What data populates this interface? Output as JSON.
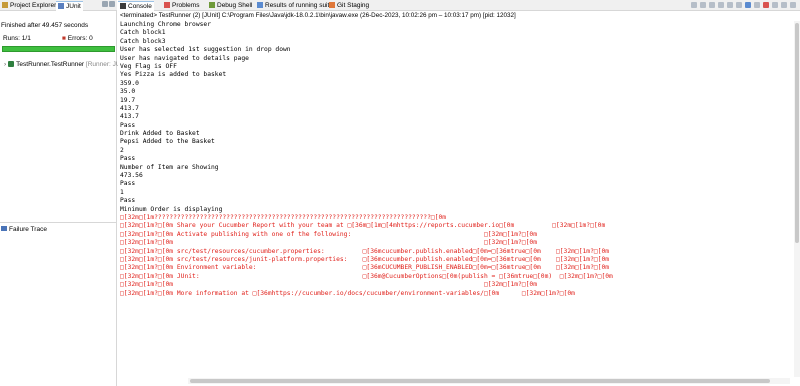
{
  "left_panel": {
    "tab_project_explorer": "Project Explorer",
    "tab_junit": "JUnit",
    "finished_text": "Finished after 49.457 seconds",
    "runs_label": "Runs:",
    "runs_value": "1/1",
    "errors_label": "Errors:",
    "errors_value": "0",
    "progress_fraction": 1.0,
    "tree_item_name": "TestRunner.TestRunner",
    "tree_item_runner": "[Runner: JUn",
    "failure_trace_label": "Failure Trace"
  },
  "right_panel": {
    "tabs": [
      "Console",
      "Problems",
      "Debug Shell",
      "Results of running suite",
      "Git Staging"
    ],
    "status_line": "<terminated> TestRunner (2) [JUnit] C:\\Program Files\\Java\\jdk-18.0.2.1\\bin\\javaw.exe  (26-Dec-2023, 10:02:26 pm – 10:03:17 pm) [pid: 12032]",
    "console_lines": [
      {
        "text": "Launching Chrome browser",
        "error": false
      },
      {
        "text": "Catch block1",
        "error": false
      },
      {
        "text": "Catch block3",
        "error": false
      },
      {
        "text": "User has selected 1st suggestion in drop down",
        "error": false
      },
      {
        "text": "User has navigated to details page",
        "error": false
      },
      {
        "text": "Veg Flag is OFF",
        "error": false
      },
      {
        "text": "Yes Pizza is added to basket",
        "error": false
      },
      {
        "text": "359.0",
        "error": false
      },
      {
        "text": "35.0",
        "error": false
      },
      {
        "text": "19.7",
        "error": false
      },
      {
        "text": "413.7",
        "error": false
      },
      {
        "text": "413.7",
        "error": false
      },
      {
        "text": "Pass",
        "error": false
      },
      {
        "text": "Drink Added to Basket",
        "error": false
      },
      {
        "text": "Pepsi Added to the Basket",
        "error": false
      },
      {
        "text": "2",
        "error": false
      },
      {
        "text": "Pass",
        "error": false
      },
      {
        "text": "Number of Item are Showing",
        "error": false
      },
      {
        "text": "473.56",
        "error": false
      },
      {
        "text": "Pass",
        "error": false
      },
      {
        "text": "1",
        "error": false
      },
      {
        "text": "Pass",
        "error": false
      },
      {
        "text": "Minimum Order is displaying",
        "error": false
      },
      {
        "text": "□[32m□[1m?????????????????????????????????????????????????????????????????????????□[0m",
        "error": true
      },
      {
        "text": "□[32m□[1m?□[0m Share your Cucumber Report with your team at □[36m□[1m□[4mhttps://reports.cucumber.io□[0m          □[32m□[1m?□[0m",
        "error": true
      },
      {
        "text": "□[32m□[1m?□[0m Activate publishing with one of the following:                                   □[32m□[1m?□[0m",
        "error": true
      },
      {
        "text": "□[32m□[1m?□[0m                                                                                  □[32m□[1m?□[0m",
        "error": true
      },
      {
        "text": "□[32m□[1m?□[0m src/test/resources/cucumber.properties:          □[36mcucumber.publish.enabled□[0m=□[36mtrue□[0m    □[32m□[1m?□[0m",
        "error": true
      },
      {
        "text": "□[32m□[1m?□[0m src/test/resources/junit-platform.properties:    □[36mcucumber.publish.enabled□[0m=□[36mtrue□[0m    □[32m□[1m?□[0m",
        "error": true
      },
      {
        "text": "□[32m□[1m?□[0m Environment variable:                            □[36mCUCUMBER_PUBLISH_ENABLED□[0m=□[36mtrue□[0m    □[32m□[1m?□[0m",
        "error": true
      },
      {
        "text": "□[32m□[1m?□[0m JUnit:                                           □[36m@CucumberOptions□[0m(publish = □[36mtrue□[0m)  □[32m□[1m?□[0m",
        "error": true
      },
      {
        "text": "□[32m□[1m?□[0m                                                                                  □[32m□[1m?□[0m",
        "error": true
      },
      {
        "text": "□[32m□[1m?□[0m More information at □[36mhttps://cucumber.io/docs/cucumber/environment-variables/□[0m      □[32m□[1m?□[0m",
        "error": true
      }
    ]
  },
  "colors": {
    "progress_green": "#3fbf3f",
    "error_red": "#e0201a",
    "tab_bar_bg": "#f0f0f0"
  }
}
